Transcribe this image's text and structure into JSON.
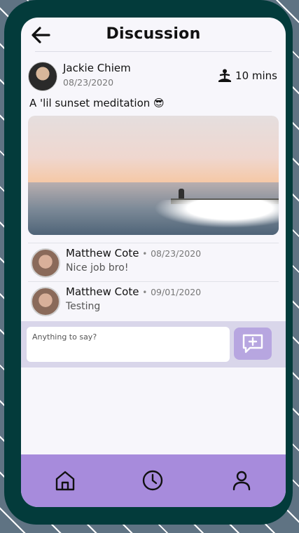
{
  "header": {
    "title": "Discussion",
    "back_icon": "arrow-left-icon"
  },
  "post": {
    "author": "Jackie Chiem",
    "date": "08/23/2020",
    "duration": "10 mins",
    "duration_icon": "meditation-icon",
    "caption": "A 'lil sunset meditation 😎"
  },
  "comments": [
    {
      "author": "Matthew Cote",
      "separator": "•",
      "date": "08/23/2020",
      "text": "Nice job bro!"
    },
    {
      "author": "Matthew Cote",
      "separator": "•",
      "date": "09/01/2020",
      "text": "Testing"
    }
  ],
  "input": {
    "placeholder": "Anything to say?",
    "value": "",
    "send_icon": "add-comment-icon"
  },
  "nav": {
    "items": [
      "home-icon",
      "history-clock-icon",
      "profile-icon"
    ]
  },
  "colors": {
    "frame": "#033b3b",
    "nav": "#a78bdc",
    "send_button": "#b7a6e0",
    "input_bar": "#d9d6ea"
  }
}
